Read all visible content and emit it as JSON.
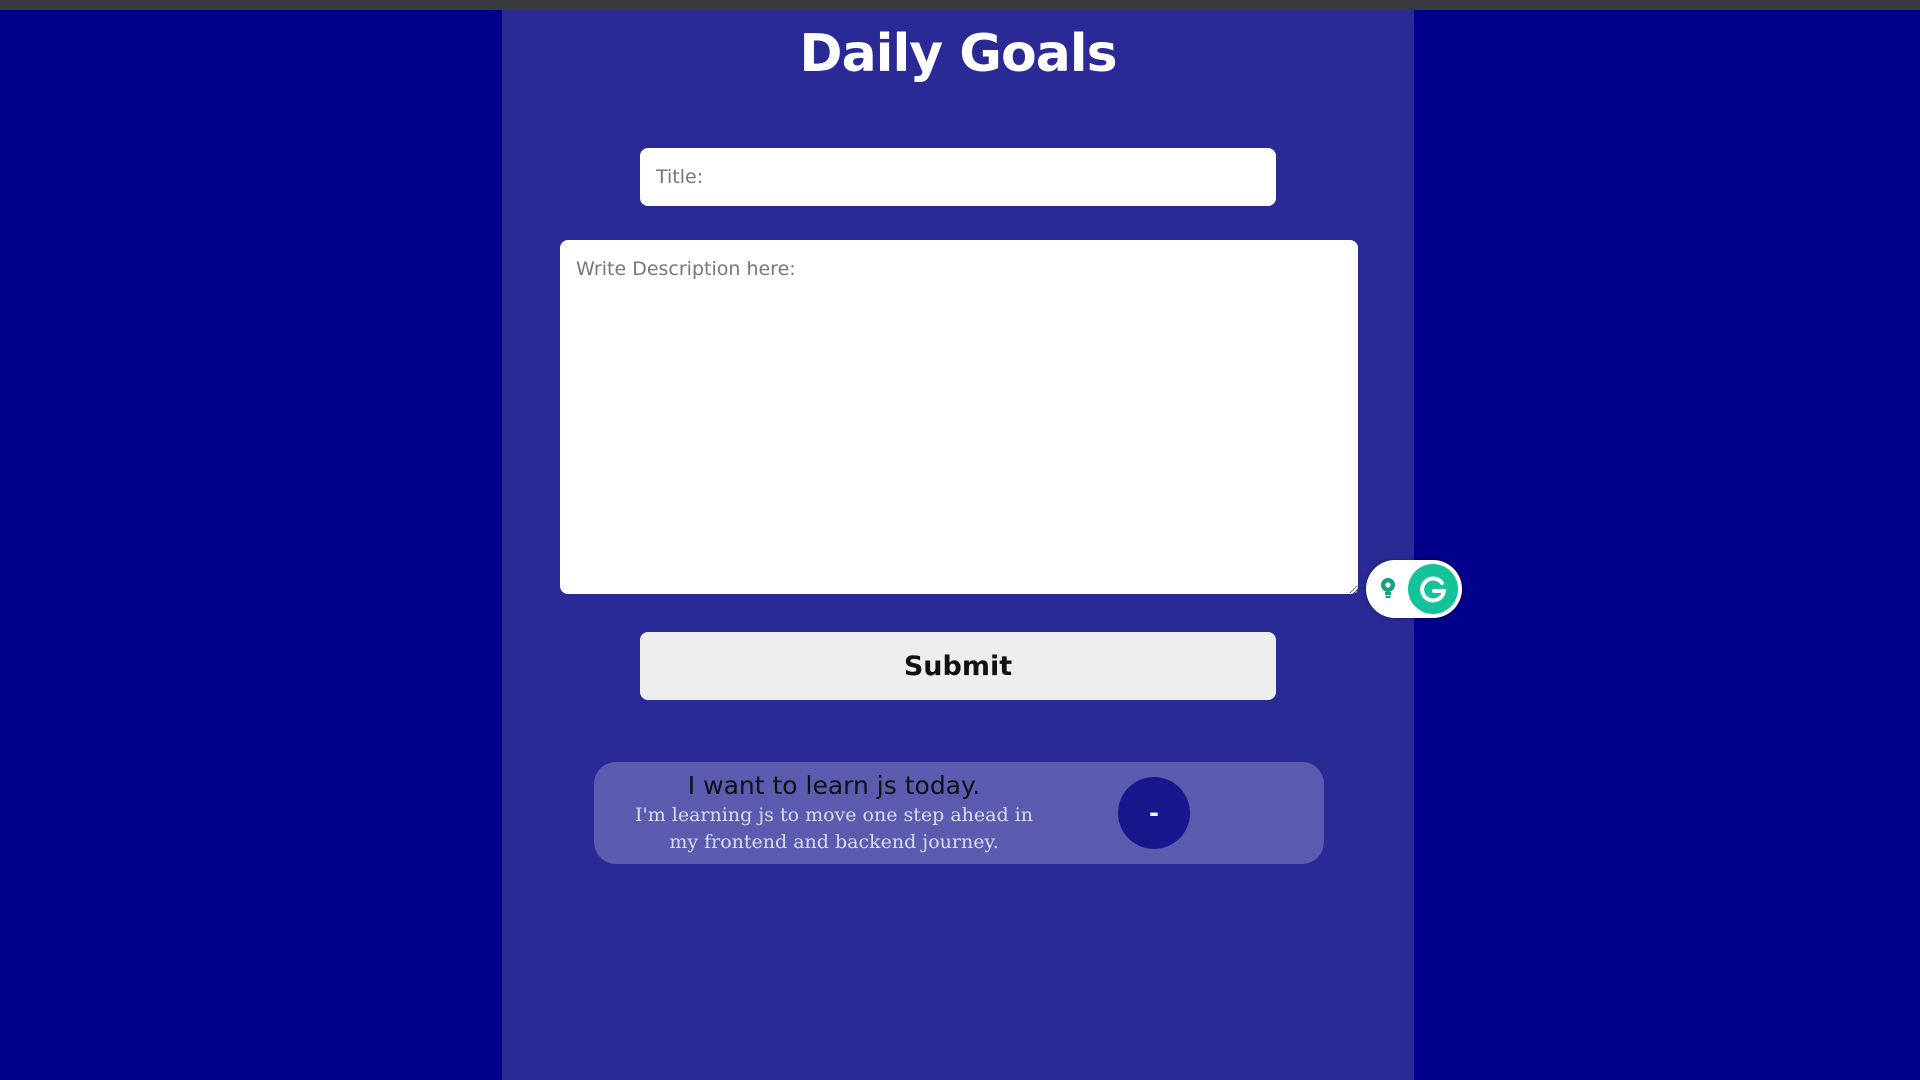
{
  "page": {
    "title": "Daily Goals"
  },
  "form": {
    "title_placeholder": "Title:",
    "title_value": "",
    "description_placeholder": "Write Description here:",
    "description_value": "",
    "submit_label": "Submit"
  },
  "goals": [
    {
      "title": "I want to learn js today.",
      "description": "I'm learning js to move one step ahead in my frontend and backend journey.",
      "remove_label": "-"
    }
  ],
  "colors": {
    "background": "#00008b",
    "panel": "#2a2a96",
    "card": "#5b5bb0",
    "remove_button": "#18188e",
    "grammarly": "#15c39a"
  },
  "icons": {
    "grammarly_suggestion": "lightbulb-icon",
    "grammarly_logo": "grammarly-icon"
  }
}
